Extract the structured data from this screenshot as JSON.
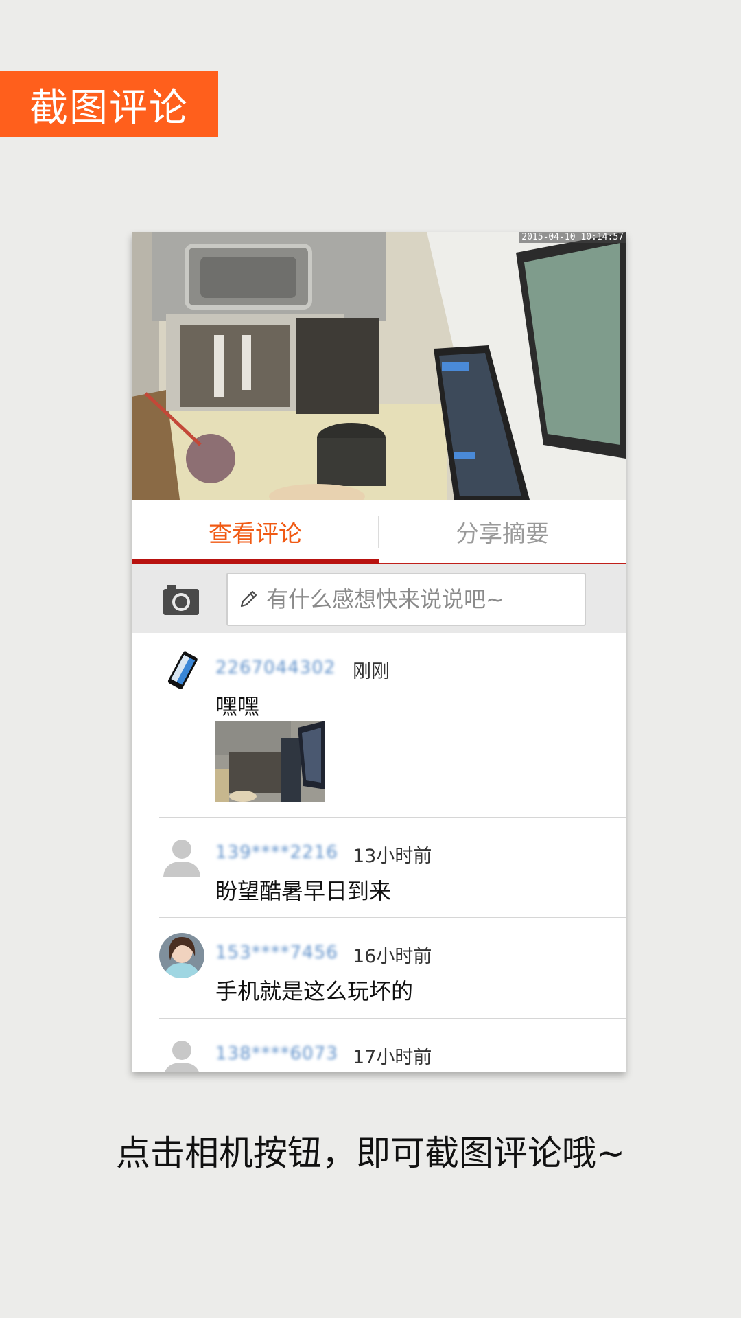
{
  "banner": {
    "title": "截图评论"
  },
  "video": {
    "timestamp": "2015-04-10 10:14:57"
  },
  "tabs": [
    {
      "label": "查看评论",
      "active": true
    },
    {
      "label": "分享摘要",
      "active": false
    }
  ],
  "comment_bar": {
    "camera_icon": "camera-icon",
    "placeholder": "有什么感想快来说说吧~",
    "value": ""
  },
  "comments": [
    {
      "user": "2267044302",
      "time": "刚刚",
      "text": "嘿嘿",
      "avatar": "phone-avatar",
      "has_image": true
    },
    {
      "user": "139****2216",
      "time": "13小时前",
      "text": "盼望酷暑早日到来",
      "avatar": "default-avatar",
      "has_image": false
    },
    {
      "user": "153****7456",
      "time": "16小时前",
      "text": "手机就是这么玩坏的",
      "avatar": "photo-avatar",
      "has_image": false
    },
    {
      "user": "138****6073",
      "time": "17小时前",
      "text": "",
      "avatar": "default-avatar",
      "has_image": false
    }
  ],
  "caption": "点击相机按钮，即可截图评论哦~",
  "colors": {
    "banner": "#ff5f1c",
    "tab_active": "#f05a14",
    "tab_underline": "#b8120f",
    "username": "#5d8fc9"
  }
}
